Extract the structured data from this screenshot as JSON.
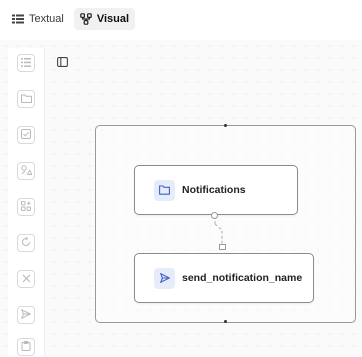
{
  "view_toggle": {
    "textual_label": "Textual",
    "visual_label": "Visual",
    "active": "Visual"
  },
  "palette": {
    "items": [
      {
        "icon": "list-icon"
      },
      {
        "icon": "folder-icon"
      },
      {
        "icon": "checkbox-icon"
      },
      {
        "icon": "shapes-icon"
      },
      {
        "icon": "grid-plus-icon"
      },
      {
        "icon": "loop-icon"
      },
      {
        "icon": "close-icon"
      },
      {
        "icon": "send-icon"
      },
      {
        "icon": "clipboard-icon"
      }
    ]
  },
  "canvas": {
    "nodes": [
      {
        "label": "Notifications",
        "icon": "folder-icon"
      },
      {
        "label": "send_notification_name",
        "icon": "send-icon"
      }
    ]
  },
  "colors": {
    "node_border": "#8c8c8c",
    "node_icon_bg": "#e6ecfa",
    "icon_blue": "#3d62c8",
    "palette_icon": "#b9b9bf"
  }
}
